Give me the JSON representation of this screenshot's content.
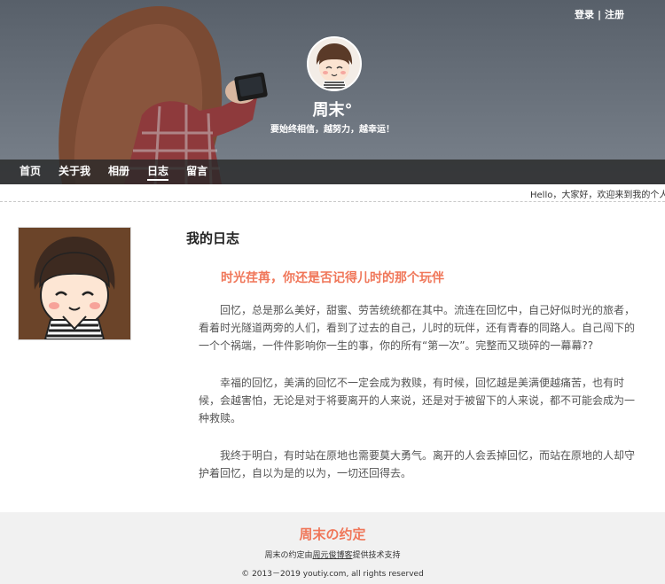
{
  "header": {
    "login": "登录",
    "separator": "|",
    "register": "注册",
    "site_name": "周末°",
    "motto": "要始终相信，越努力，越幸运！"
  },
  "nav": {
    "items": [
      {
        "label": "首页"
      },
      {
        "label": "关于我"
      },
      {
        "label": "相册"
      },
      {
        "label": "日志",
        "active": true
      },
      {
        "label": "留言"
      }
    ]
  },
  "welcome": "Hello，大家好，欢迎来到我的个人",
  "main": {
    "page_title": "我的日志",
    "article_title": "时光荏苒，你还是否记得儿时的那个玩伴",
    "paragraphs": [
      "回忆，总是那么美好，甜蜜、劳苦统统都在其中。流连在回忆中，自己好似时光的旅者，看着时光隧道两旁的人们，看到了过去的自己，儿时的玩伴，还有青春的同路人。自己闯下的一个个祸端，一件件影响你一生的事，你的所有“第一次”。完整而又琐碎的一幕幕??",
      "幸福的回忆，美满的回忆不一定会成为救赎，有时候，回忆越是美满便越痛苦，也有时候，会越害怕，无论是对于将要离开的人来说，还是对于被留下的人来说，都不可能会成为一种救赎。",
      "我终于明白，有时站在原地也需要莫大勇气。离开的人会丢掉回忆，而站在原地的人却守护着回忆，自以为是的以为，一切还回得去。"
    ]
  },
  "footer": {
    "brand": "周末の约定",
    "support_prefix": "周末の约定由",
    "support_link": "周元俊博客",
    "support_suffix": "提供技术支持",
    "copyright": "© 2013－2019 youtiy.com, all rights reserved"
  },
  "colors": {
    "accent": "#f0775a",
    "nav_bg": "#2b2b2b",
    "footer_bg": "#f1f1f1"
  },
  "icons": {
    "hero_avatar": "cartoon-boy-icon",
    "side_avatar": "cartoon-boy-icon"
  }
}
